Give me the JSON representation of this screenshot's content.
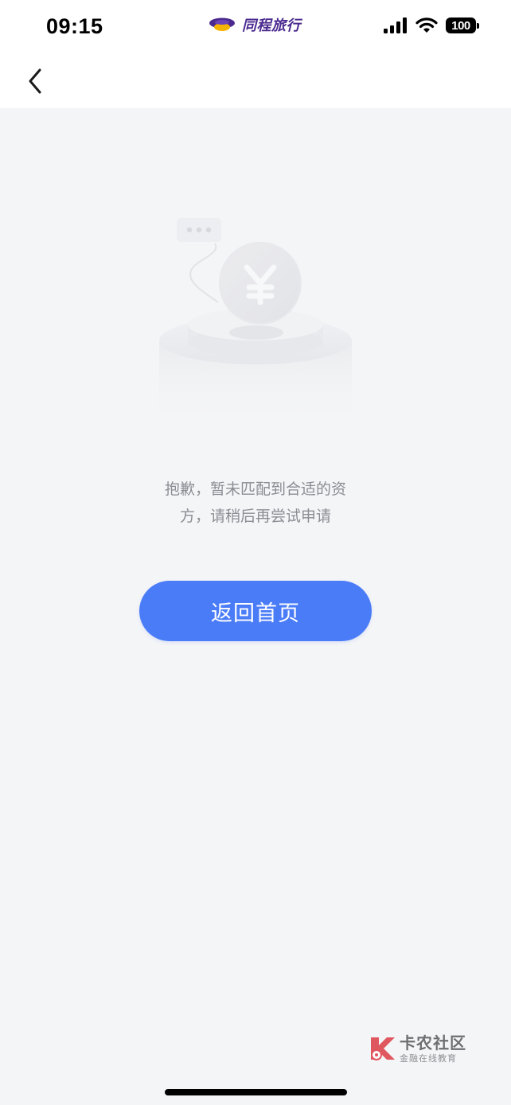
{
  "status_bar": {
    "time": "09:15",
    "carrier_name": "同程旅行",
    "battery_level": "100"
  },
  "empty_state": {
    "message_line_1": "抱歉，暂未匹配到合适的资",
    "message_line_2": "方，请稍后再尝试申请"
  },
  "actions": {
    "home_button_label": "返回首页"
  },
  "watermark": {
    "title": "卡农社区",
    "subtitle": "金融在线教育"
  },
  "colors": {
    "primary_button": "#4b7cf8",
    "background": "#f4f5f7",
    "message_text": "#8a8d93",
    "carrier_brand": "#4b2a8f"
  },
  "icons": {
    "back": "chevron-left-icon",
    "signal": "cellular-signal-icon",
    "wifi": "wifi-icon",
    "battery": "battery-icon",
    "carrier": "carrier-logo-icon",
    "illustration": "empty-coin-illustration"
  }
}
